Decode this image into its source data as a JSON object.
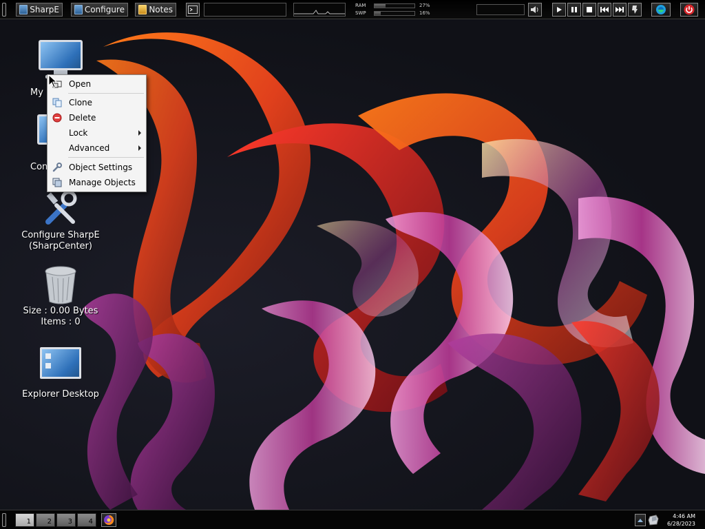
{
  "top_panel": {
    "sharpe_label": "SharpE",
    "configure_label": "Configure",
    "notes_label": "Notes",
    "ram_label": "RAM",
    "ram_percent": "27%",
    "ram_value": 0.27,
    "swp_label": "SWP",
    "swp_percent": "16%",
    "swp_value": 0.16
  },
  "desktop": {
    "icons": [
      {
        "label": "My Computer",
        "visible_label": "My"
      },
      {
        "label": "Control Panel",
        "visible_label": "Con"
      },
      {
        "label_line1": "Configure SharpE",
        "label_line2": "(SharpCenter)"
      },
      {
        "label_line1": "Size : 0.00 Bytes",
        "label_line2": "Items : 0"
      },
      {
        "label": "Explorer Desktop"
      }
    ]
  },
  "context_menu": {
    "items": [
      {
        "label": "Open"
      },
      {
        "label": "Clone"
      },
      {
        "label": "Delete"
      },
      {
        "label": "Lock"
      },
      {
        "label": "Advanced"
      },
      {
        "label": "Object Settings"
      },
      {
        "label": "Manage Objects"
      }
    ]
  },
  "bottom_panel": {
    "workspaces": [
      "1",
      "2",
      "3",
      "4"
    ],
    "time": "4:46 AM",
    "date": "6/28/2023"
  },
  "colors": {
    "accent_blue": "#2e70b9",
    "delete_red": "#e04040",
    "power_red": "#d8262a"
  }
}
